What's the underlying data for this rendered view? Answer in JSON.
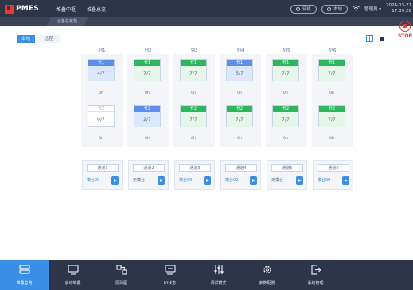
{
  "header": {
    "logo_text": "PMES",
    "nav": [
      "堆叠中枢",
      "堆叠总览"
    ],
    "status_pills": [
      "待机",
      "本地"
    ],
    "user": "管理员",
    "date": "2024-03-27",
    "time": "17:39:28"
  },
  "breadcrumb": "设备总览机",
  "tabs": {
    "local": "本地",
    "remote": "远程"
  },
  "stop_label": "STOP",
  "columns": [
    {
      "title": "列1",
      "cells": [
        {
          "label": "仓1",
          "color": "blue",
          "value": "4/7",
          "sub": "0h"
        },
        {
          "label": "仓2",
          "color": "gray",
          "value": "0/7",
          "sub": "0h"
        }
      ]
    },
    {
      "title": "列2",
      "cells": [
        {
          "label": "仓1",
          "color": "green",
          "value": "7/7",
          "sub": "0h"
        },
        {
          "label": "仓2",
          "color": "blue",
          "value": "2/7",
          "sub": "0h"
        }
      ]
    },
    {
      "title": "列3",
      "cells": [
        {
          "label": "仓1",
          "color": "green",
          "value": "7/7",
          "sub": "0h"
        },
        {
          "label": "仓2",
          "color": "green",
          "value": "7/7",
          "sub": "0h"
        }
      ]
    },
    {
      "title": "列4",
      "cells": [
        {
          "label": "仓1",
          "color": "blue",
          "value": "5/7",
          "sub": "0h"
        },
        {
          "label": "仓2",
          "color": "green",
          "value": "7/7",
          "sub": "0h"
        }
      ]
    },
    {
      "title": "列5",
      "cells": [
        {
          "label": "仓1",
          "color": "green",
          "value": "7/7",
          "sub": "0h"
        },
        {
          "label": "仓2",
          "color": "green",
          "value": "7/7",
          "sub": "0h"
        }
      ]
    },
    {
      "title": "列6",
      "cells": [
        {
          "label": "仓1",
          "color": "green",
          "value": "7/7",
          "sub": "0h"
        },
        {
          "label": "仓2",
          "color": "green",
          "value": "7/7",
          "sub": "0h"
        }
      ]
    }
  ],
  "channels": [
    {
      "title": "通道1",
      "value": "模台99",
      "active": true
    },
    {
      "title": "通道2",
      "value": "无模台",
      "active": false
    },
    {
      "title": "通道3",
      "value": "模台99",
      "active": true
    },
    {
      "title": "通道4",
      "value": "模台99",
      "active": true
    },
    {
      "title": "通道5",
      "value": "无模台",
      "active": false
    },
    {
      "title": "通道6",
      "value": "模台99",
      "active": true
    }
  ],
  "bottom_nav": [
    {
      "label": "堆叠总览",
      "icon": "stack-icon",
      "active": true
    },
    {
      "label": "手动堆叠",
      "icon": "monitor-icon",
      "active": false
    },
    {
      "label": "层列图",
      "icon": "layout-icon",
      "active": false
    },
    {
      "label": "IO状态",
      "icon": "io-icon",
      "active": false
    },
    {
      "label": "调试模式",
      "icon": "sliders-icon",
      "active": false
    },
    {
      "label": "参数配置",
      "icon": "gear-icon",
      "active": false
    },
    {
      "label": "系统管理",
      "icon": "logout-icon",
      "active": false
    }
  ],
  "colors": {
    "header_bg": "#2e3548",
    "accent": "#3a8ee6",
    "green": "#2fb55e",
    "blue": "#5b8fe8",
    "stop": "#e8392c"
  }
}
